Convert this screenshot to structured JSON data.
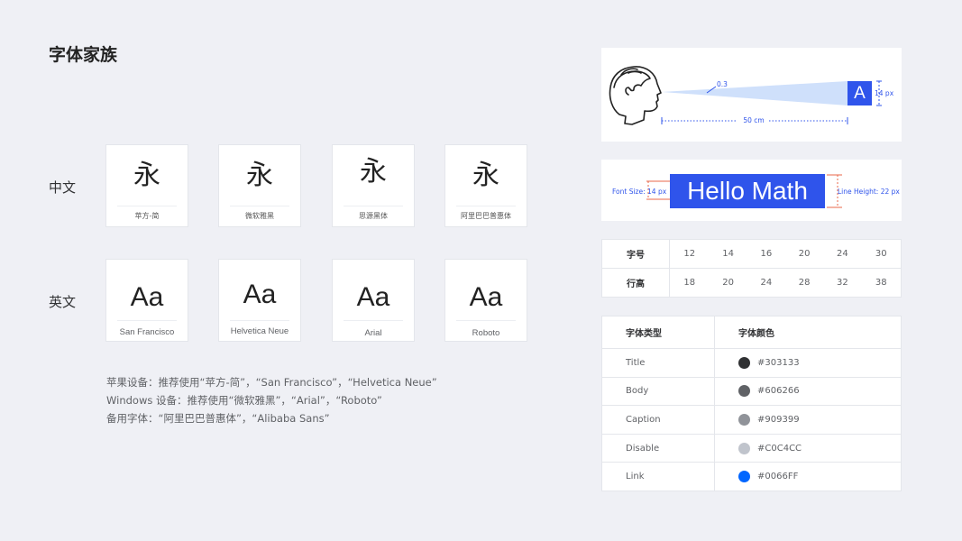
{
  "title": "字体家族",
  "rows": {
    "chinese_label": "中文",
    "english_label": "英文"
  },
  "chinese_cards": [
    {
      "glyph": "永",
      "name": "苹方-简"
    },
    {
      "glyph": "永",
      "name": "微软雅黑"
    },
    {
      "glyph": "永",
      "name": "思源黑体"
    },
    {
      "glyph": "永",
      "name": "阿里巴巴普惠体"
    }
  ],
  "english_cards": [
    {
      "glyph": "Aa",
      "name": "San Francisco"
    },
    {
      "glyph": "Aa",
      "name": "Helvetica Neue"
    },
    {
      "glyph": "Aa",
      "name": "Arial"
    },
    {
      "glyph": "Aa",
      "name": "Roboto"
    }
  ],
  "notes": [
    "苹果设备：推荐使用“苹方-简”，“San Francisco”，“Helvetica Neue”",
    "Windows 设备：推荐使用“微软雅黑”，“Arial”，“Roboto”",
    "备用字体：“阿里巴巴普惠体”，“Alibaba Sans”"
  ],
  "viewing": {
    "angle": "0.3",
    "letter": "A",
    "letter_size": "14 px",
    "distance": "50 cm"
  },
  "hello": {
    "text": "Hello Math",
    "font_size_label": "Font Size: 14 px",
    "line_height_label": "Line Height: 22 px"
  },
  "size_table": {
    "size_label": "字号",
    "line_label": "行高",
    "sizes": [
      "12",
      "14",
      "16",
      "20",
      "24",
      "30"
    ],
    "line_heights": [
      "18",
      "20",
      "24",
      "28",
      "32",
      "38"
    ]
  },
  "color_table": {
    "header_type": "字体类型",
    "header_color": "字体颜色",
    "rows": [
      {
        "type": "Title",
        "hex": "#303133",
        "color": "#303133"
      },
      {
        "type": "Body",
        "hex": "#606266",
        "color": "#606266"
      },
      {
        "type": "Caption",
        "hex": "#909399",
        "color": "#909399"
      },
      {
        "type": "Disable",
        "hex": "#C0C4CC",
        "color": "#C0C4CC"
      },
      {
        "type": "Link",
        "hex": "#0066FF",
        "color": "#0066FF"
      }
    ]
  },
  "colors": {
    "accent": "#2F54EB",
    "background": "#EFF0F5",
    "guide_red": "#E8674A"
  }
}
